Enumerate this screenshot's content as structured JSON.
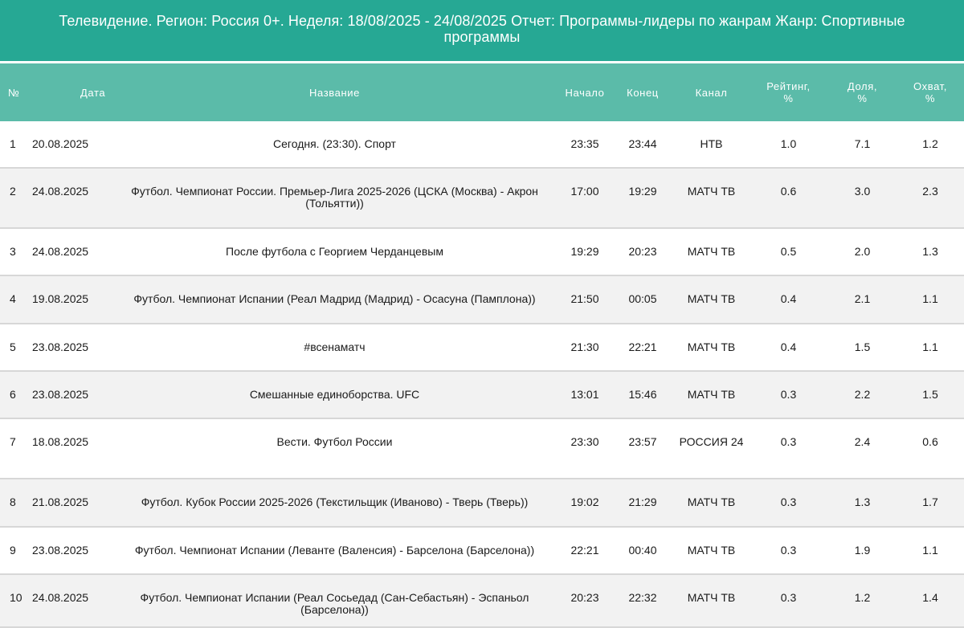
{
  "header": {
    "title": "Телевидение. Регион: Россия 0+. Неделя: 18/08/2025 - 24/08/2025 Отчет: Программы-лидеры по жанрам Жанр: Спортивные программы"
  },
  "table": {
    "columns": {
      "num": "№",
      "date": "Дата",
      "name": "Название",
      "start": "Начало",
      "end": "Конец",
      "channel": "Канал",
      "rating_line1": "Рейтинг,",
      "rating_line2": "%",
      "share_line1": "Доля,",
      "share_line2": "%",
      "reach_line1": "Охват,",
      "reach_line2": "%"
    },
    "rows": [
      {
        "num": "1",
        "date": "20.08.2025",
        "name": "Сегодня. (23:30). Спорт",
        "start": "23:35",
        "end": "23:44",
        "channel": "НТВ",
        "rating": "1.0",
        "share": "7.1",
        "reach": "1.2"
      },
      {
        "num": "2",
        "date": "24.08.2025",
        "name": "Футбол. Чемпионат России. Премьер-Лига 2025-2026 (ЦСКА (Москва) - Акрон (Тольятти))",
        "start": "17:00",
        "end": "19:29",
        "channel": "МАТЧ ТВ",
        "rating": "0.6",
        "share": "3.0",
        "reach": "2.3"
      },
      {
        "num": "3",
        "date": "24.08.2025",
        "name": "После футбола с Георгием Черданцевым",
        "start": "19:29",
        "end": "20:23",
        "channel": "МАТЧ ТВ",
        "rating": "0.5",
        "share": "2.0",
        "reach": "1.3"
      },
      {
        "num": "4",
        "date": "19.08.2025",
        "name": "Футбол. Чемпионат Испании (Реал Мадрид (Мадрид) - Осасуна (Памплона))",
        "start": "21:50",
        "end": "00:05",
        "channel": "МАТЧ ТВ",
        "rating": "0.4",
        "share": "2.1",
        "reach": "1.1"
      },
      {
        "num": "5",
        "date": "23.08.2025",
        "name": "#всенаматч",
        "start": "21:30",
        "end": "22:21",
        "channel": "МАТЧ ТВ",
        "rating": "0.4",
        "share": "1.5",
        "reach": "1.1"
      },
      {
        "num": "6",
        "date": "23.08.2025",
        "name": "Смешанные единоборства. UFC",
        "start": "13:01",
        "end": "15:46",
        "channel": "МАТЧ ТВ",
        "rating": "0.3",
        "share": "2.2",
        "reach": "1.5"
      },
      {
        "num": "7",
        "date": "18.08.2025",
        "name": "Вести. Футбол России",
        "start": "23:30",
        "end": "23:57",
        "channel": "РОССИЯ 24",
        "rating": "0.3",
        "share": "2.4",
        "reach": "0.6"
      },
      {
        "num": "8",
        "date": "21.08.2025",
        "name": "Футбол. Кубок России 2025-2026 (Текстильщик (Иваново) - Тверь (Тверь))",
        "start": "19:02",
        "end": "21:29",
        "channel": "МАТЧ ТВ",
        "rating": "0.3",
        "share": "1.3",
        "reach": "1.7"
      },
      {
        "num": "9",
        "date": "23.08.2025",
        "name": "Футбол. Чемпионат Испании (Леванте (Валенсия) - Барселона (Барселона))",
        "start": "22:21",
        "end": "00:40",
        "channel": "МАТЧ ТВ",
        "rating": "0.3",
        "share": "1.9",
        "reach": "1.1"
      },
      {
        "num": "10",
        "date": "24.08.2025",
        "name": "Футбол. Чемпионат Испании (Реал Сосьедад (Сан-Себастьян) - Эспаньол (Барселона))",
        "start": "20:23",
        "end": "22:32",
        "channel": "МАТЧ ТВ",
        "rating": "0.3",
        "share": "1.2",
        "reach": "1.4"
      }
    ]
  },
  "colors": {
    "title_bg": "#26a894",
    "header_bg": "#5bbba9",
    "row_alt_bg": "#f2f2f2",
    "row_border": "#d7d7d7"
  }
}
